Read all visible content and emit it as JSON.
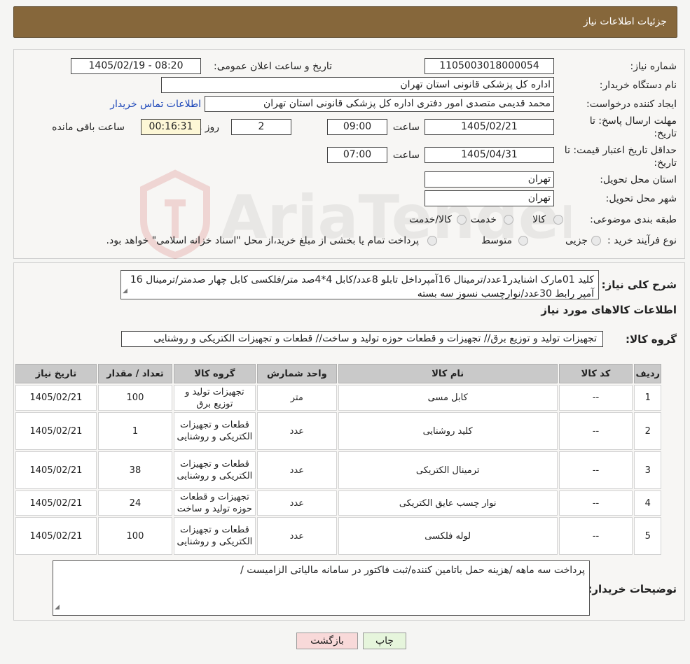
{
  "header": {
    "title": "جزئیات اطلاعات نیاز"
  },
  "need": {
    "number_label": "شماره نیاز:",
    "number": "1105003018000054",
    "announce_label": "تاریخ و ساعت اعلان عمومی:",
    "announce_value": "1405/02/19 - 08:20",
    "buyer_label": "نام دستگاه خریدار:",
    "buyer_value": "اداره کل پزشکی قانونی استان تهران",
    "creator_label": "ایجاد کننده درخواست:",
    "creator_value": "محمد قدیمی متصدی امور دفتری اداره کل پزشکی قانونی استان تهران",
    "contact_link": "اطلاعات تماس خریدار",
    "deadline_label_1": "مهلت ارسال پاسخ: تا",
    "deadline_label_2": "تاریخ:",
    "deadline_date": "1405/02/21",
    "time_label": "ساعت",
    "deadline_time": "09:00",
    "days_value": "2",
    "days_label": "روز و",
    "remaining_time": "00:16:31",
    "remaining_label": "ساعت باقی مانده",
    "validity_label_1": "حداقل تاریخ اعتبار قیمت: تا",
    "validity_label_2": "تاریخ:",
    "validity_date": "1405/04/31",
    "validity_time": "07:00",
    "province_label": "استان محل تحویل:",
    "province_value": "تهران",
    "city_label": "شهر محل تحویل:",
    "city_value": "تهران",
    "category_label": "طبقه بندی موضوعی:",
    "category_options": [
      "کالا",
      "خدمت",
      "کالا/خدمت"
    ],
    "process_label": "نوع فرآیند خرید :",
    "process_options": [
      "جزیی",
      "متوسط"
    ],
    "process_note": "پرداخت تمام یا بخشی از مبلغ خرید،از محل \"اسناد خزانه اسلامی\" خواهد بود."
  },
  "summary": {
    "label": "شرح کلی نیاز:",
    "text": "کلید 01مارک اشنایدر1عدد/ترمینال 16آمپرداخل تابلو 8عدد/کابل 4*4صد متر/فلکسی کابل چهار صدمتر/ترمینال 16 آمپر رابط 30عدد/نوارچسب نسوز سه بسته"
  },
  "goods": {
    "section_title": "اطلاعات کالاهای مورد نیاز",
    "group_label": "گروه کالا:",
    "group_value": "تجهیزات تولید و توزیع برق// تجهیزات و قطعات حوزه تولید و ساخت// قطعات و تجهیزات الکتریکی و روشنایی"
  },
  "table": {
    "headers": [
      "ردیف",
      "کد کالا",
      "نام کالا",
      "واحد شمارش",
      "گروه کالا",
      "تعداد / مقدار",
      "تاریخ نیاز"
    ],
    "rows": [
      {
        "row": "1",
        "code": "--",
        "name": "کابل مسی",
        "unit": "متر",
        "group": "تجهیزات تولید و توزیع برق",
        "qty": "100",
        "date": "1405/02/21"
      },
      {
        "row": "2",
        "code": "--",
        "name": "کلید روشنایی",
        "unit": "عدد",
        "group": "قطعات و تجهیزات الکتریکی و روشنایی",
        "qty": "1",
        "date": "1405/02/21"
      },
      {
        "row": "3",
        "code": "--",
        "name": "ترمینال الکتریکی",
        "unit": "عدد",
        "group": "قطعات و تجهیزات الکتریکی و روشنایی",
        "qty": "38",
        "date": "1405/02/21"
      },
      {
        "row": "4",
        "code": "--",
        "name": "نوار چسب عایق الکتریکی",
        "unit": "عدد",
        "group": "تجهیزات و قطعات حوزه تولید و ساخت",
        "qty": "24",
        "date": "1405/02/21"
      },
      {
        "row": "5",
        "code": "--",
        "name": "لوله فلکسی",
        "unit": "عدد",
        "group": "قطعات و تجهیزات الکتریکی و روشنایی",
        "qty": "100",
        "date": "1405/02/21"
      }
    ]
  },
  "buyer_notes": {
    "label": "توضیحات خریدار:",
    "text": "پرداخت سه ماهه /هزینه حمل باتامین کننده/ثبت فاکتور در سامانه مالیاتی الزامیست /"
  },
  "buttons": {
    "print": "چاپ",
    "back": "بازگشت"
  },
  "watermark": {
    "text": "AriaTender.neT"
  },
  "colors": {
    "header": "#86673b",
    "link": "#1a44b8",
    "highlight": "#fdf7d6",
    "back_button": "#f8d9d9",
    "print_button": "#e6f5dc"
  }
}
